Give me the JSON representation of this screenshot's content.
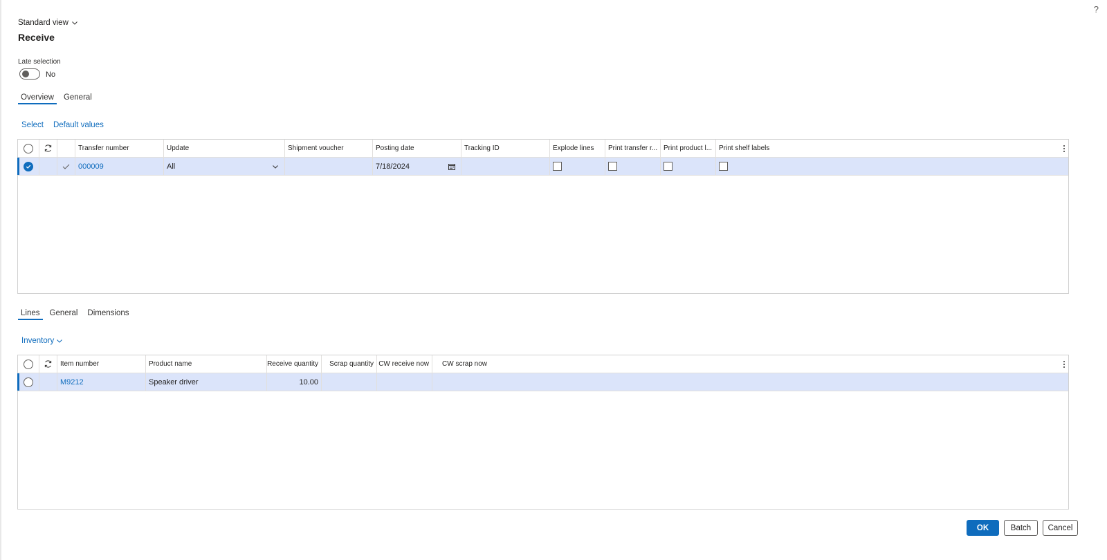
{
  "header": {
    "view_label": "Standard view",
    "title": "Receive",
    "help": "?"
  },
  "late_selection": {
    "label": "Late selection",
    "value": "No"
  },
  "top_tabs": [
    {
      "label": "Overview",
      "active": true
    },
    {
      "label": "General",
      "active": false
    }
  ],
  "top_actions": {
    "select": "Select",
    "default_values": "Default values"
  },
  "overview_grid": {
    "columns": {
      "transfer_number": "Transfer number",
      "update": "Update",
      "shipment_voucher": "Shipment voucher",
      "posting_date": "Posting date",
      "tracking_id": "Tracking ID",
      "explode_lines": "Explode lines",
      "print_transfer": "Print transfer r...",
      "print_product": "Print product l...",
      "print_shelf": "Print shelf labels"
    },
    "rows": [
      {
        "transfer_number": "000009",
        "update": "All",
        "shipment_voucher": "",
        "posting_date": "7/18/2024",
        "tracking_id": "",
        "explode_lines": false,
        "print_transfer": false,
        "print_product": false,
        "print_shelf": false
      }
    ]
  },
  "bottom_tabs": [
    {
      "label": "Lines",
      "active": true
    },
    {
      "label": "General",
      "active": false
    },
    {
      "label": "Dimensions",
      "active": false
    }
  ],
  "bottom_actions": {
    "inventory": "Inventory"
  },
  "lines_grid": {
    "columns": {
      "item_number": "Item number",
      "product_name": "Product name",
      "receive_quantity": "Receive quantity",
      "scrap_quantity": "Scrap quantity",
      "cw_receive_now": "CW receive now",
      "cw_scrap_now": "CW scrap now"
    },
    "rows": [
      {
        "item_number": "M9212",
        "product_name": "Speaker driver",
        "receive_quantity": "10.00",
        "scrap_quantity": "",
        "cw_receive_now": "",
        "cw_scrap_now": ""
      }
    ]
  },
  "footer": {
    "ok": "OK",
    "batch": "Batch",
    "cancel": "Cancel"
  },
  "colors": {
    "accent": "#0f6cbd",
    "selected_row": "#dbe4fa"
  }
}
